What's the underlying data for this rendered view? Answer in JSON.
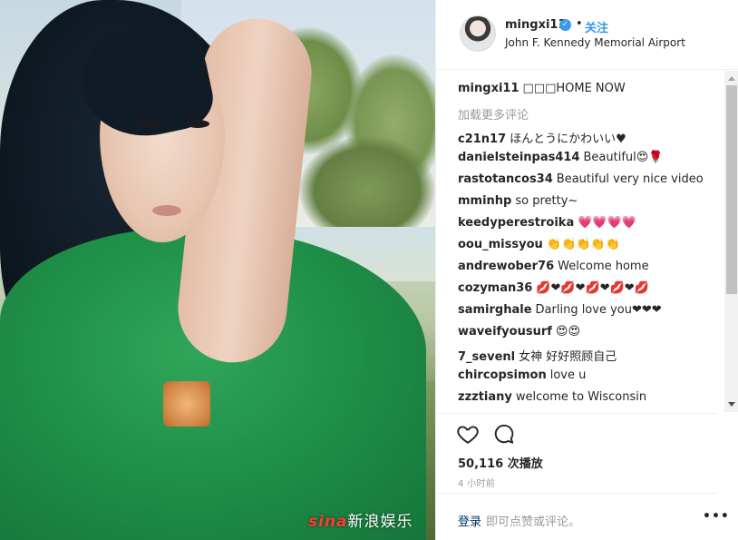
{
  "post": {
    "username": "mingxi11",
    "follow_label": "关注",
    "separator": "•",
    "verified_icon": "verified-badge-icon",
    "location": "John F. Kennedy Memorial Airport"
  },
  "media": {
    "watermark_brand": "sina",
    "watermark_text": "新浪娱乐"
  },
  "caption": {
    "user": "mingxi11",
    "text": "□□□HOME NOW"
  },
  "load_more": "加载更多评论",
  "comments": [
    {
      "user": "c21n17",
      "text": "ほんとうにかわいい♥"
    },
    {
      "user": "danielsteinpas414",
      "text": "Beautiful😍🌹"
    },
    {
      "user": "rastotancos34",
      "text": "Beautiful very nice video"
    },
    {
      "user": "mminhp",
      "text": "so pretty~"
    },
    {
      "user": "keedyperestroika",
      "text": "💗💗💗💗"
    },
    {
      "user": "oou_missyou",
      "text": "👏👏👏👏👏"
    },
    {
      "user": "andrewober76",
      "text": "Welcome home"
    },
    {
      "user": "cozyman36",
      "text": "💋❤💋❤💋❤💋❤💋"
    },
    {
      "user": "samirghale",
      "text": "Darling love you❤❤❤"
    },
    {
      "user": "waveifyousurf",
      "text": "😍😍"
    },
    {
      "user": "7_sevenl",
      "text": "女神 好好照顾自己"
    },
    {
      "user": "chircopsimon",
      "text": "love u"
    },
    {
      "user": "zzztiany",
      "text": "welcome to Wisconsin"
    }
  ],
  "actions": {
    "like_icon": "heart-icon",
    "comment_icon": "comment-icon",
    "views": "50,116 次播放",
    "time": "4 小时前"
  },
  "footer": {
    "login": "登录",
    "text": "即可点赞或评论。",
    "more": "•••"
  }
}
